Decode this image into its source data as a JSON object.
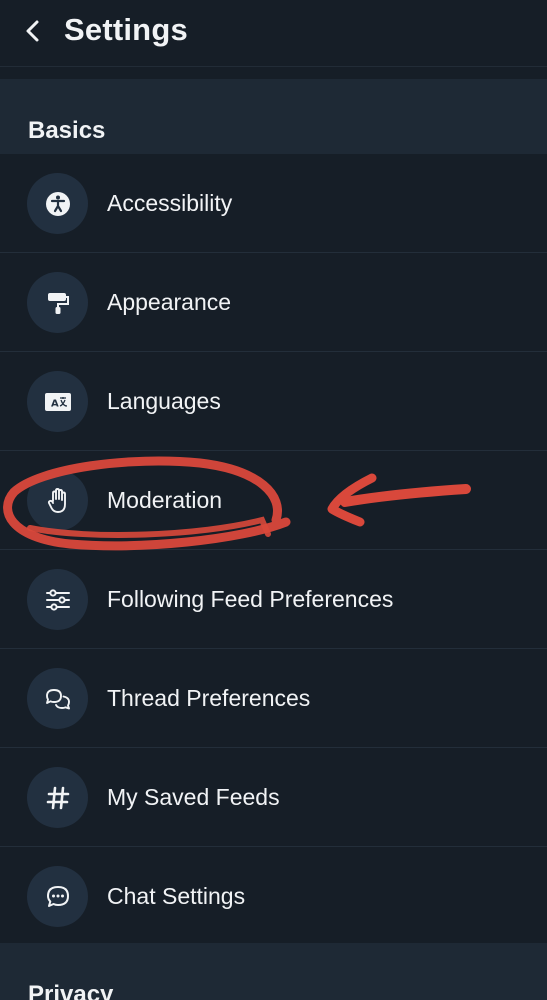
{
  "header": {
    "title": "Settings",
    "back_icon": "chevron-left-icon"
  },
  "sections": [
    {
      "title": "Basics",
      "items": [
        {
          "label": "Accessibility",
          "icon": "accessibility-icon"
        },
        {
          "label": "Appearance",
          "icon": "paint-roller-icon"
        },
        {
          "label": "Languages",
          "icon": "language-icon"
        },
        {
          "label": "Moderation",
          "icon": "hand-icon"
        },
        {
          "label": "Following Feed Preferences",
          "icon": "sliders-icon"
        },
        {
          "label": "Thread Preferences",
          "icon": "chat-bubbles-icon"
        },
        {
          "label": "My Saved Feeds",
          "icon": "hash-icon"
        },
        {
          "label": "Chat Settings",
          "icon": "chat-dots-icon"
        }
      ]
    },
    {
      "title": "Privacy"
    }
  ],
  "annotation": {
    "description_color": "#d9483b",
    "marks": [
      "circle-around-moderation",
      "arrow-pointing-left"
    ]
  },
  "colors": {
    "background": "#161e27",
    "section_background": "#1e2935",
    "icon_circle": "#223040",
    "text": "#f1f3f5"
  }
}
